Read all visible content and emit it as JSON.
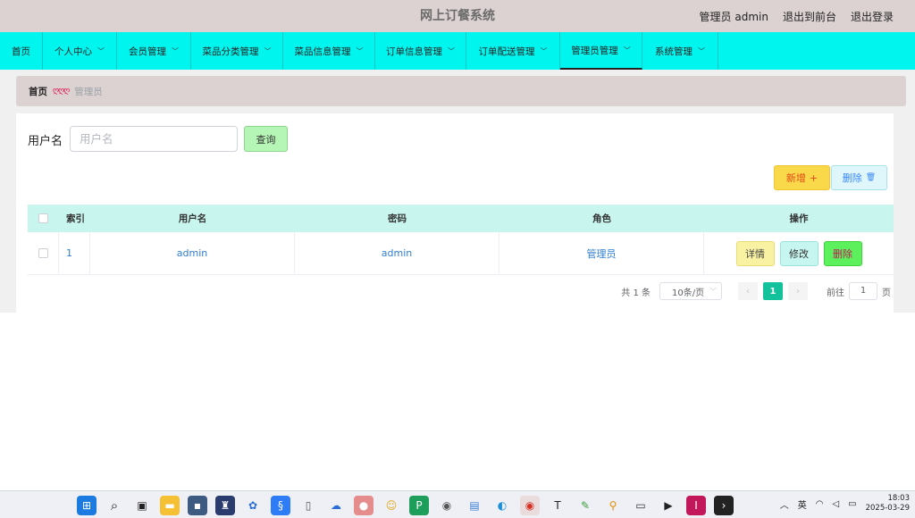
{
  "header": {
    "app_title": "网上订餐系统",
    "user": "管理员 admin",
    "back_to_front": "退出到前台",
    "logout": "退出登录"
  },
  "nav": {
    "items": [
      {
        "label": "首页",
        "has_dropdown": false
      },
      {
        "label": "个人中心",
        "has_dropdown": true
      },
      {
        "label": "会员管理",
        "has_dropdown": true
      },
      {
        "label": "菜品分类管理",
        "has_dropdown": true
      },
      {
        "label": "菜品信息管理",
        "has_dropdown": true
      },
      {
        "label": "订单信息管理",
        "has_dropdown": true
      },
      {
        "label": "订单配送管理",
        "has_dropdown": true
      },
      {
        "label": "管理员管理",
        "has_dropdown": true,
        "active": true
      },
      {
        "label": "系统管理",
        "has_dropdown": true
      }
    ]
  },
  "breadcrumb": {
    "home": "首页",
    "separator": "ღღღ",
    "current": "管理员"
  },
  "search": {
    "label": "用户名",
    "placeholder": "用户名",
    "query_button": "查询"
  },
  "actions": {
    "add_label": "新增",
    "add_icon": "+",
    "delete_label": "删除",
    "delete_icon": "🗑"
  },
  "table": {
    "headers": {
      "index": "索引",
      "username": "用户名",
      "password": "密码",
      "role": "角色",
      "ops": "操作"
    },
    "rows": [
      {
        "index": "1",
        "username": "admin",
        "password": "admin",
        "role": "管理员"
      }
    ],
    "row_buttons": {
      "detail": "详情",
      "edit": "修改",
      "delete": "删除"
    }
  },
  "pagination": {
    "total": "共 1 条",
    "page_size": "10条/页",
    "prev": "‹",
    "current_page": "1",
    "next": "›",
    "goto_label": "前往",
    "goto_value": "1",
    "goto_suffix": "页"
  },
  "taskbar": {
    "tray_lang": "英",
    "time": "18:03",
    "date": "2025-03-29"
  },
  "colors": {
    "topbar": "#dcd2d2",
    "navbar": "#00f5ee",
    "table_header": "#c8f5ee",
    "pager_active": "#13c29b"
  }
}
